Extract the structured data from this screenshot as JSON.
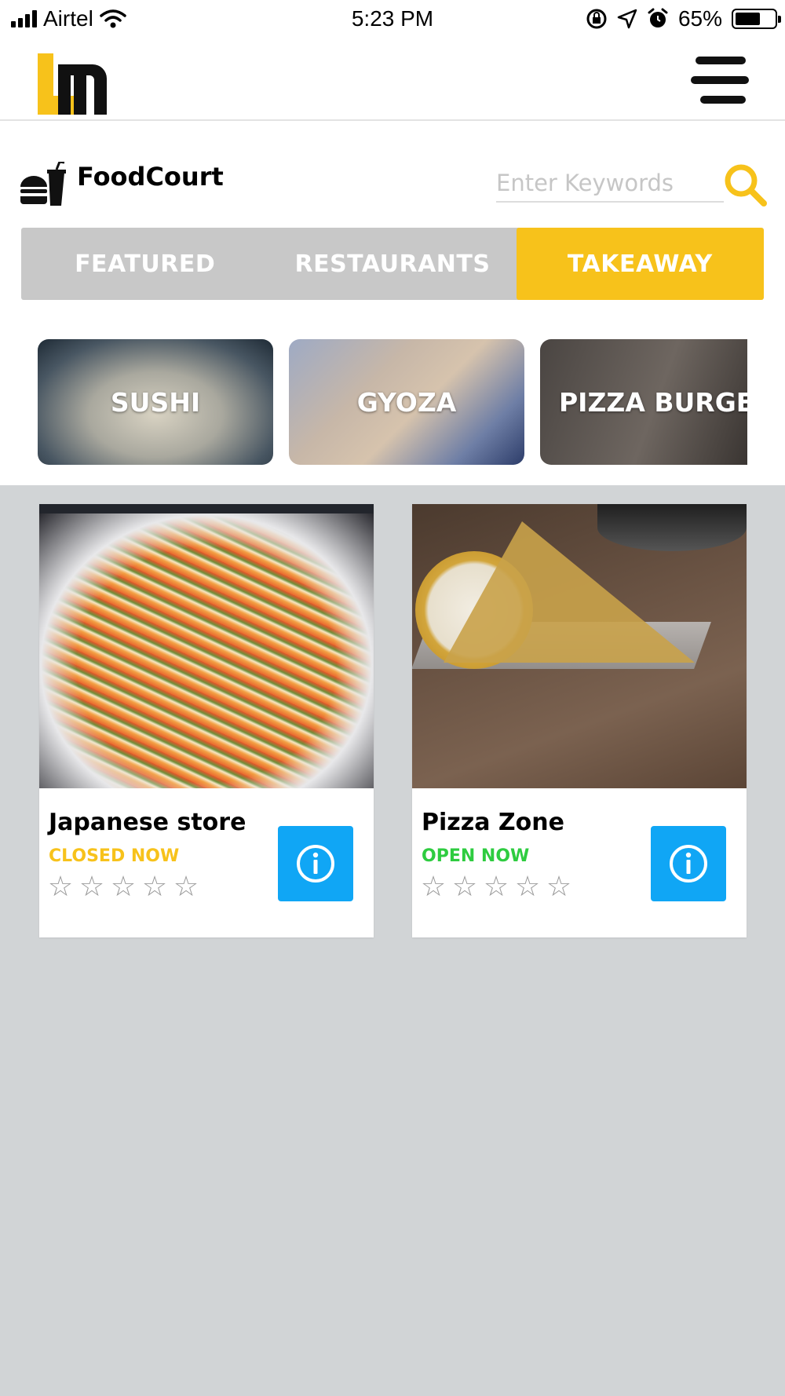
{
  "status_bar": {
    "carrier": "Airtel",
    "time": "5:23 PM",
    "battery": "65%",
    "battery_level": 0.65,
    "icons": [
      "signal-icon",
      "wifi-icon",
      "rotation-lock-icon",
      "location-arrow-icon",
      "alarm-icon",
      "battery-icon"
    ]
  },
  "header": {
    "logo_icon": "lm-logo-icon",
    "menu_icon": "hamburger-menu-icon"
  },
  "brand": {
    "name": "FoodCourt",
    "icon": "burger-drink-icon"
  },
  "search": {
    "placeholder": "Enter Keywords",
    "value": "",
    "icon": "search-icon"
  },
  "tabs": [
    {
      "label": "FEATURED",
      "active": false
    },
    {
      "label": "RESTAURANTS",
      "active": false
    },
    {
      "label": "TAKEAWAY",
      "active": true
    }
  ],
  "categories": [
    {
      "label": "SUSHI"
    },
    {
      "label": "GYOZA"
    },
    {
      "label": "PIZZA BURGER"
    }
  ],
  "stores": [
    {
      "name": "Japanese store",
      "status": "CLOSED NOW",
      "status_color": "#f7c21b",
      "rating": 0,
      "max_rating": 5,
      "info_icon": "info-icon"
    },
    {
      "name": "Pizza Zone",
      "status": "OPEN NOW",
      "status_color": "#2ecc40",
      "rating": 0,
      "max_rating": 5,
      "info_icon": "info-icon"
    }
  ],
  "colors": {
    "accent": "#f7c21b",
    "tab_bar": "#c8c8c8",
    "info_button": "#10a6f5",
    "listing_background": "#d1d4d6"
  }
}
